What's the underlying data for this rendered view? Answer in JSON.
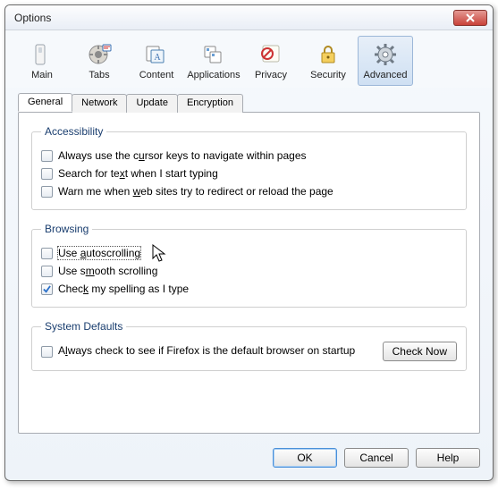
{
  "window": {
    "title": "Options"
  },
  "toolbar": {
    "items": [
      {
        "id": "main",
        "label": "Main"
      },
      {
        "id": "tabs",
        "label": "Tabs"
      },
      {
        "id": "content",
        "label": "Content"
      },
      {
        "id": "applications",
        "label": "Applications"
      },
      {
        "id": "privacy",
        "label": "Privacy"
      },
      {
        "id": "security",
        "label": "Security"
      },
      {
        "id": "advanced",
        "label": "Advanced"
      }
    ],
    "active": "advanced"
  },
  "tabs": {
    "items": [
      "General",
      "Network",
      "Update",
      "Encryption"
    ],
    "active": "General"
  },
  "groups": {
    "accessibility": {
      "legend": "Accessibility",
      "items": [
        {
          "label_html": "Always use the c<u>u</u>rsor keys to navigate within pages",
          "checked": false
        },
        {
          "label_html": "Search for te<u>x</u>t when I start typing",
          "checked": false
        },
        {
          "label_html": "Warn me when <u>w</u>eb sites try to redirect or reload the page",
          "checked": false
        }
      ]
    },
    "browsing": {
      "legend": "Browsing",
      "items": [
        {
          "label_html": "Use <u>a</u>utoscrolling",
          "checked": false,
          "focus": true
        },
        {
          "label_html": "Use s<u>m</u>ooth scrolling",
          "checked": false
        },
        {
          "label_html": "Chec<u>k</u> my spelling as I type",
          "checked": true
        }
      ]
    },
    "system": {
      "legend": "System Defaults",
      "label_html": "A<u>l</u>ways check to see if Firefox is the default browser on startup",
      "checked": false,
      "button": "Check Now"
    }
  },
  "buttons": {
    "ok": "OK",
    "cancel": "Cancel",
    "help": "Help"
  }
}
